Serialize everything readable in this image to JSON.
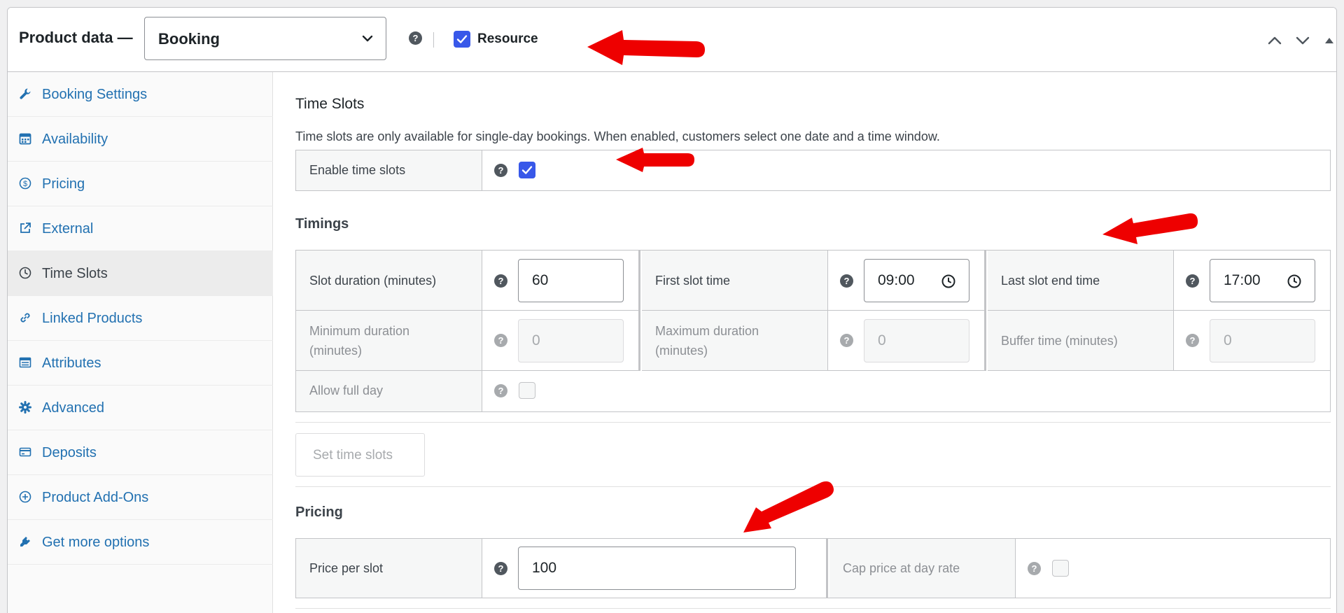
{
  "header": {
    "title": "Product data —",
    "product_type": "Booking",
    "resource_label": "Resource",
    "resource_checked": true
  },
  "sidebar": {
    "items": [
      {
        "label": "Booking Settings",
        "icon": "wrench-icon"
      },
      {
        "label": "Availability",
        "icon": "calendar-icon"
      },
      {
        "label": "Pricing",
        "icon": "dollar-icon"
      },
      {
        "label": "External",
        "icon": "external-link-icon"
      },
      {
        "label": "Time Slots",
        "icon": "clock-icon",
        "active": true
      },
      {
        "label": "Linked Products",
        "icon": "link-icon"
      },
      {
        "label": "Attributes",
        "icon": "list-icon"
      },
      {
        "label": "Advanced",
        "icon": "gear-icon"
      },
      {
        "label": "Deposits",
        "icon": "card-icon"
      },
      {
        "label": "Product Add-Ons",
        "icon": "plus-circle-icon"
      },
      {
        "label": "Get more options",
        "icon": "plugin-icon"
      }
    ]
  },
  "time_slots": {
    "title": "Time Slots",
    "description": "Time slots are only available for single-day bookings. When enabled, customers select one date and a time window.",
    "enable_label": "Enable time slots",
    "enable_checked": true
  },
  "timings": {
    "title": "Timings",
    "slot_duration_label": "Slot duration (minutes)",
    "slot_duration_value": "60",
    "first_slot_label": "First slot time",
    "first_slot_value": "09:00",
    "last_slot_label": "Last slot end time",
    "last_slot_value": "17:00",
    "min_duration_label": "Minimum duration (minutes)",
    "min_duration_value": "0",
    "max_duration_label": "Maximum duration (minutes)",
    "max_duration_value": "0",
    "buffer_label": "Buffer time (minutes)",
    "buffer_value": "0",
    "full_day_label": "Allow full day",
    "set_button": "Set time slots"
  },
  "pricing": {
    "title": "Pricing",
    "price_label": "Price per slot",
    "price_value": "100",
    "cap_label": "Cap price at day rate"
  },
  "colors": {
    "accent": "#3858e9",
    "link": "#2271b1",
    "annotation_arrow": "#ee0000"
  }
}
